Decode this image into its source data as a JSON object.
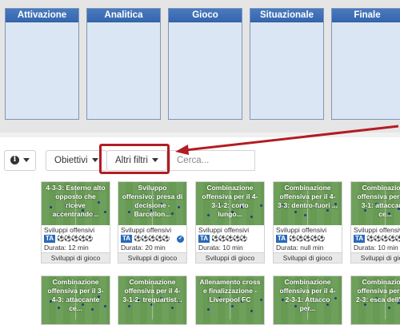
{
  "phases": [
    {
      "label": "Attivazione"
    },
    {
      "label": "Analitica"
    },
    {
      "label": "Gioco"
    },
    {
      "label": "Situazionale"
    },
    {
      "label": "Finale"
    }
  ],
  "toolbar": {
    "info_icon": "info-circle-icon",
    "objectives_label": "Obiettivi",
    "filters_label": "Altri filtri",
    "search_placeholder": "Cerca..."
  },
  "annotation": {
    "color": "#b21c24"
  },
  "cards_row1": [
    {
      "title": "4-3-3: Esterno alto opposto che riceve accentrando...",
      "category": "Sviluppi offensivi",
      "badge": "TA",
      "duration": "Durata: 12 min",
      "footer": "Sviluppi di gioco",
      "checked": false
    },
    {
      "title": "Sviluppo offensivo: presa di decisione - Barcellon...",
      "category": "Sviluppi offensivi",
      "badge": "TA",
      "duration": "Durata: 20 min",
      "footer": "Sviluppi di gioco",
      "checked": true
    },
    {
      "title": "Combinazione offensiva per il 4-3-1-2: corto lungo...",
      "category": "Sviluppi offensivi",
      "badge": "TA",
      "duration": "Durata: 10 min",
      "footer": "Sviluppi di gioco",
      "checked": false
    },
    {
      "title": "Combinazione offensiva per il 4-3-3: dentro-fuori ...",
      "category": "Sviluppi offensivi",
      "badge": "TA",
      "duration": "Durata: null min",
      "footer": "Sviluppi di gioco",
      "checked": false
    },
    {
      "title": "Combinazione offensiva per il 4-3-1: attaccante ce...",
      "category": "Sviluppi offensivi",
      "badge": "TA",
      "duration": "Durata: 10 min",
      "footer": "Sviluppi di gioco",
      "checked": false
    }
  ],
  "cards_row2": [
    {
      "title": "Combinazione offensiva per il 3-4-3: attaccante ce..."
    },
    {
      "title": "Combinazione offensiva per il 4-3-1-2: trequartist..."
    },
    {
      "title": "Allenamento cross e finalizzazione - Liverpool FC"
    },
    {
      "title": "Combinazione offensiva per il 4-2-3-1: Attacco per..."
    },
    {
      "title": "Combinazione offensiva per il 4-2-3: esca dell'att..."
    }
  ]
}
